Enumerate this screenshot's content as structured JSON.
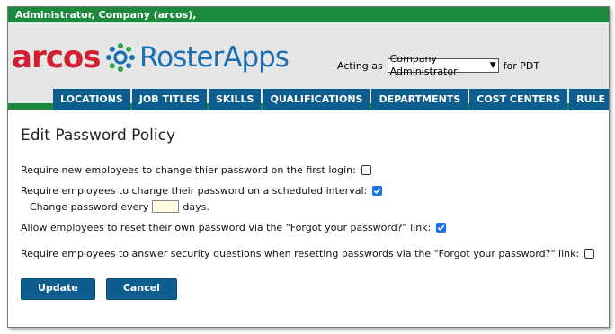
{
  "topbar": {
    "user_text": "Administrator, Company (arcos),"
  },
  "logo": {
    "brand_left": "arcos",
    "brand_right": "RosterApps",
    "accent": "#d0202f",
    "brand_blue": "#1a6fb4"
  },
  "acting": {
    "label_before": "Acting as",
    "selected": "Company Administrator",
    "label_after": "for PDT"
  },
  "nav": {
    "tabs": [
      "LOCATIONS",
      "JOB TITLES",
      "SKILLS",
      "QUALIFICATIONS",
      "DEPARTMENTS",
      "COST CENTERS",
      "RULE SETS"
    ]
  },
  "page": {
    "title": "Edit Password Policy"
  },
  "options": {
    "first_login": {
      "label": "Require new employees to change thier password on the first login:",
      "checked": false
    },
    "scheduled": {
      "label": "Require employees to change their password on a scheduled interval:",
      "checked": true
    },
    "interval": {
      "prefix": "Change password every",
      "value": "",
      "suffix": "days."
    },
    "reset_self": {
      "label": "Allow employees to reset their own password via the \"Forgot your password?\" link:",
      "checked": true
    },
    "security_q": {
      "label": "Require employees to answer security questions when resetting passwords via the \"Forgot your password?\" link:",
      "checked": false
    }
  },
  "buttons": {
    "update": "Update",
    "cancel": "Cancel"
  },
  "colors": {
    "green": "#1b8a3c",
    "nav_blue": "#0d5e8f",
    "check_blue": "#1a73e8"
  }
}
